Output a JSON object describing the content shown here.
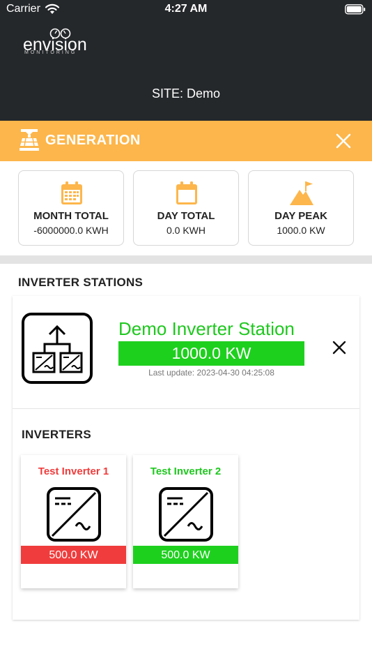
{
  "status_bar": {
    "carrier": "Carrier",
    "time": "4:27 AM"
  },
  "brand": {
    "logo_word": "envision",
    "logo_sub": "MONITORING"
  },
  "site": {
    "title": "SITE: Demo"
  },
  "generation": {
    "title": "GENERATION",
    "color": "#fdb64b",
    "stats": [
      {
        "icon": "calendar-month-icon",
        "label": "MONTH TOTAL",
        "value": "-6000000.0 KWH"
      },
      {
        "icon": "calendar-day-icon",
        "label": "DAY TOTAL",
        "value": "0.0 KWH"
      },
      {
        "icon": "mountain-flag-icon",
        "label": "DAY PEAK",
        "value": "1000.0 KW"
      }
    ]
  },
  "inverter_stations": {
    "title": "INVERTER STATIONS",
    "station": {
      "icon": "inverter-station-icon",
      "name": "Demo Inverter Station",
      "power": "1000.0 KW",
      "last_update": "Last update: 2023-04-30 04:25:08",
      "status_color": "#1ed01e"
    }
  },
  "inverters": {
    "title": "INVERTERS",
    "items": [
      {
        "name": "Test Inverter 1",
        "power": "500.0 KW",
        "status_color": "#f03c3c",
        "icon": "inverter-icon"
      },
      {
        "name": "Test Inverter 2",
        "power": "500.0 KW",
        "status_color": "#1ed01e",
        "icon": "inverter-icon"
      }
    ]
  }
}
